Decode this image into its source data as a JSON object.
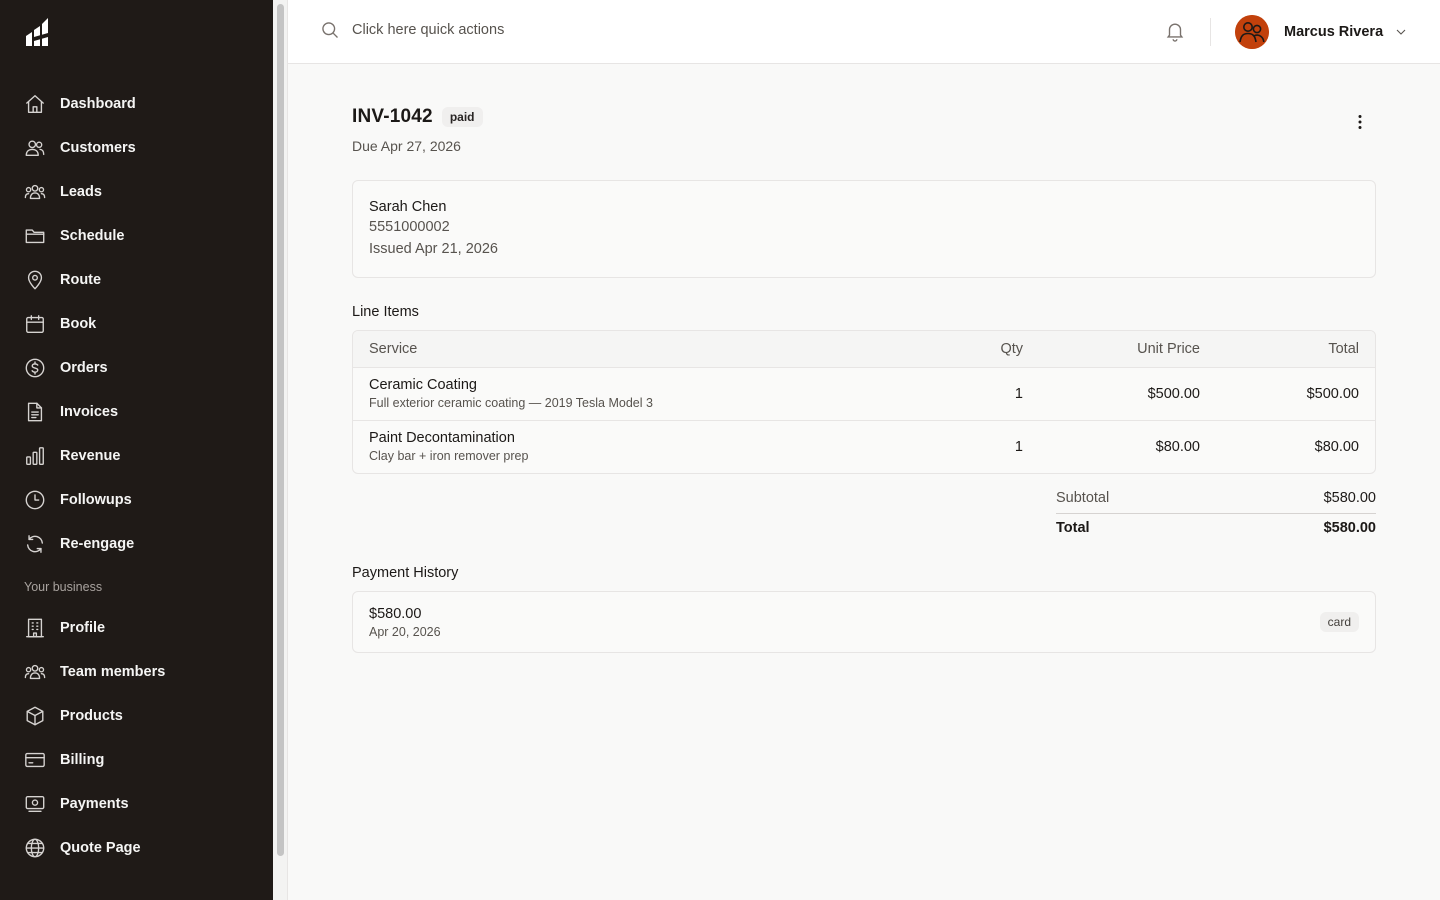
{
  "topbar": {
    "search_placeholder": "Click here quick actions",
    "user_name": "Marcus Rivera"
  },
  "sidebar": {
    "items": [
      {
        "label": "Dashboard",
        "icon": "home-icon"
      },
      {
        "label": "Customers",
        "icon": "users-icon"
      },
      {
        "label": "Leads",
        "icon": "user-group-icon"
      },
      {
        "label": "Schedule",
        "icon": "folder-icon"
      },
      {
        "label": "Route",
        "icon": "map-pin-icon"
      },
      {
        "label": "Book",
        "icon": "calendar-icon"
      },
      {
        "label": "Orders",
        "icon": "dollar-icon"
      },
      {
        "label": "Invoices",
        "icon": "document-icon"
      },
      {
        "label": "Revenue",
        "icon": "bar-chart-icon"
      },
      {
        "label": "Followups",
        "icon": "clock-icon"
      },
      {
        "label": "Re-engage",
        "icon": "refresh-icon"
      }
    ],
    "section_label": "Your business",
    "business_items": [
      {
        "label": "Profile",
        "icon": "building-icon"
      },
      {
        "label": "Team members",
        "icon": "team-icon"
      },
      {
        "label": "Products",
        "icon": "cube-icon"
      },
      {
        "label": "Billing",
        "icon": "credit-card-icon"
      },
      {
        "label": "Payments",
        "icon": "banknote-icon"
      },
      {
        "label": "Quote Page",
        "icon": "globe-icon"
      }
    ]
  },
  "invoice": {
    "number": "INV-1042",
    "status": "paid",
    "due": "Due Apr 27, 2026",
    "customer": {
      "name": "Sarah Chen",
      "phone": "5551000002",
      "issued": "Issued Apr 21, 2026"
    },
    "line_items_title": "Line Items",
    "columns": {
      "service": "Service",
      "qty": "Qty",
      "unit_price": "Unit Price",
      "total": "Total"
    },
    "line_items": [
      {
        "name": "Ceramic Coating",
        "desc": "Full exterior ceramic coating — 2019 Tesla Model 3",
        "qty": "1",
        "unit_price": "$500.00",
        "total": "$500.00"
      },
      {
        "name": "Paint Decontamination",
        "desc": "Clay bar + iron remover prep",
        "qty": "1",
        "unit_price": "$80.00",
        "total": "$80.00"
      }
    ],
    "subtotal_label": "Subtotal",
    "subtotal": "$580.00",
    "total_label": "Total",
    "total": "$580.00",
    "payment_history_title": "Payment History",
    "payments": [
      {
        "amount": "$580.00",
        "date": "Apr 20, 2026",
        "method": "card"
      }
    ]
  },
  "colors": {
    "sidebar_bg": "#1f1a17",
    "avatar": "#c2410c",
    "page_bg": "#f9f9f8"
  }
}
